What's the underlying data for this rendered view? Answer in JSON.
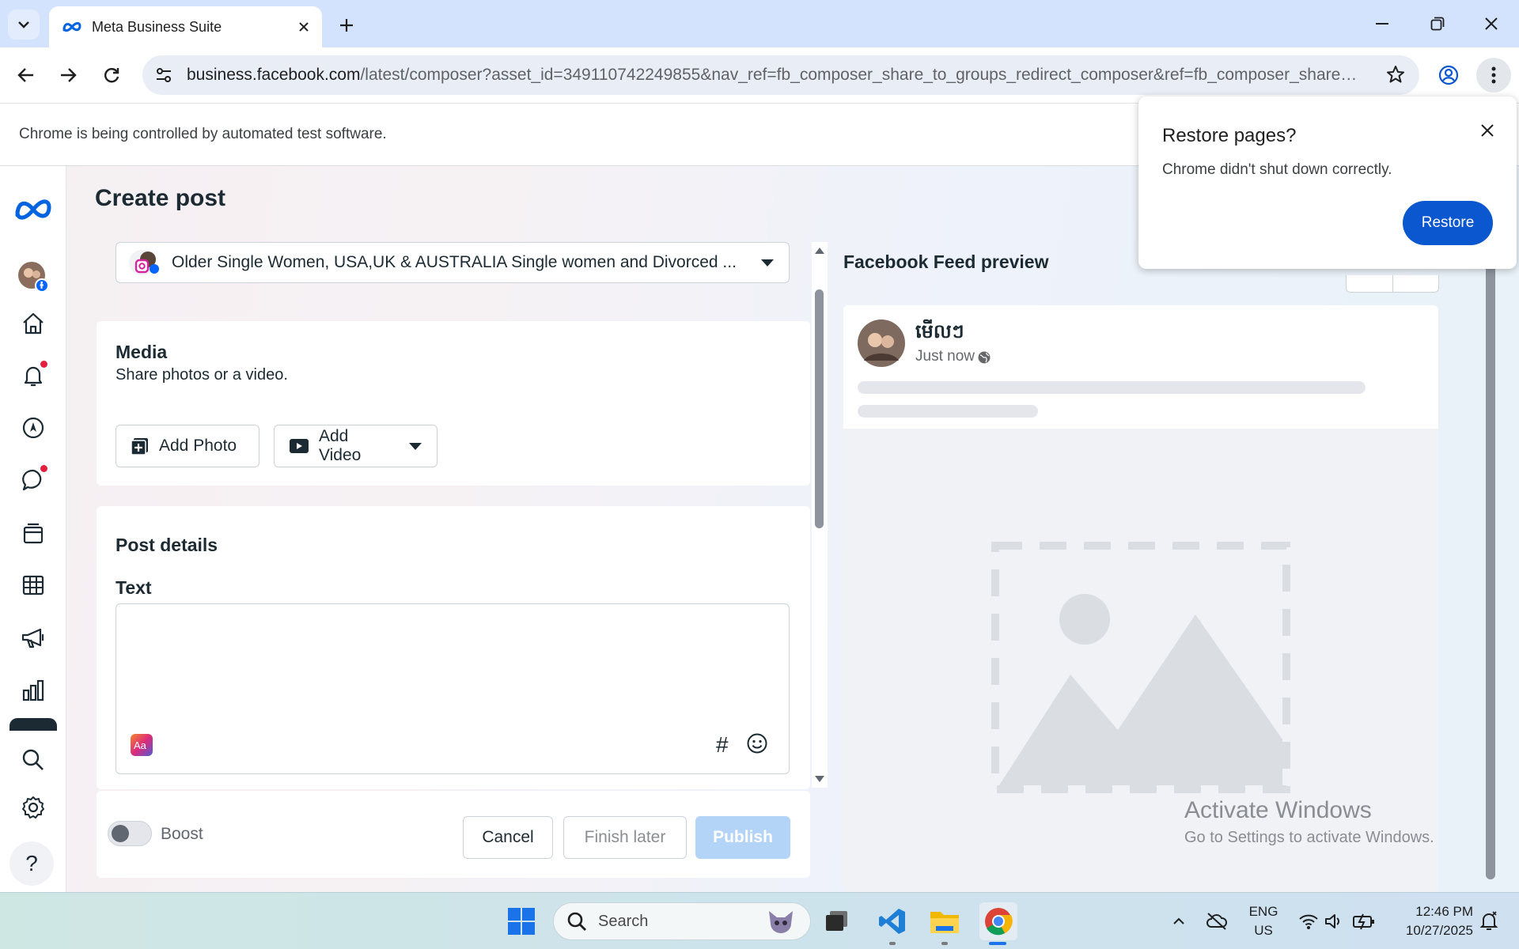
{
  "browser": {
    "tab_title": "Meta Business Suite",
    "url_host": "business.facebook.com",
    "url_path": "/latest/composer?asset_id=349110742249855&nav_ref=fb_composer_share_to_groups_redirect_composer&ref=fb_composer_share_to_...",
    "infobar_text": "Chrome is being controlled by automated test software."
  },
  "restore_popup": {
    "title": "Restore pages?",
    "message": "Chrome didn't shut down correctly.",
    "button": "Restore"
  },
  "composer": {
    "page_title": "Create post",
    "destination": "Older Single Women, USA,UK & AUSTRALIA Single women and Divorced ...",
    "media": {
      "title": "Media",
      "subtitle": "Share photos or a video.",
      "add_photo": "Add Photo",
      "add_video": "Add Video"
    },
    "post_details": {
      "title": "Post details",
      "text_label": "Text",
      "text_value": ""
    },
    "footer": {
      "boost_label": "Boost",
      "boost_on": false,
      "cancel": "Cancel",
      "finish_later": "Finish later",
      "publish": "Publish"
    }
  },
  "preview": {
    "title": "Facebook Feed preview",
    "page_name": "មើលៗ",
    "timestamp": "Just now"
  },
  "watermark": {
    "line1": "Activate Windows",
    "line2": "Go to Settings to activate Windows."
  },
  "taskbar": {
    "search_placeholder": "Search",
    "lang_line1": "ENG",
    "lang_line2": "US",
    "time": "12:46 PM",
    "date": "10/27/2025"
  },
  "colors": {
    "chrome_accent": "#0b57d0",
    "meta_blue": "#0064e0",
    "publish_disabled": "#b4d4f7",
    "notification_dot": "#e41e3f"
  }
}
